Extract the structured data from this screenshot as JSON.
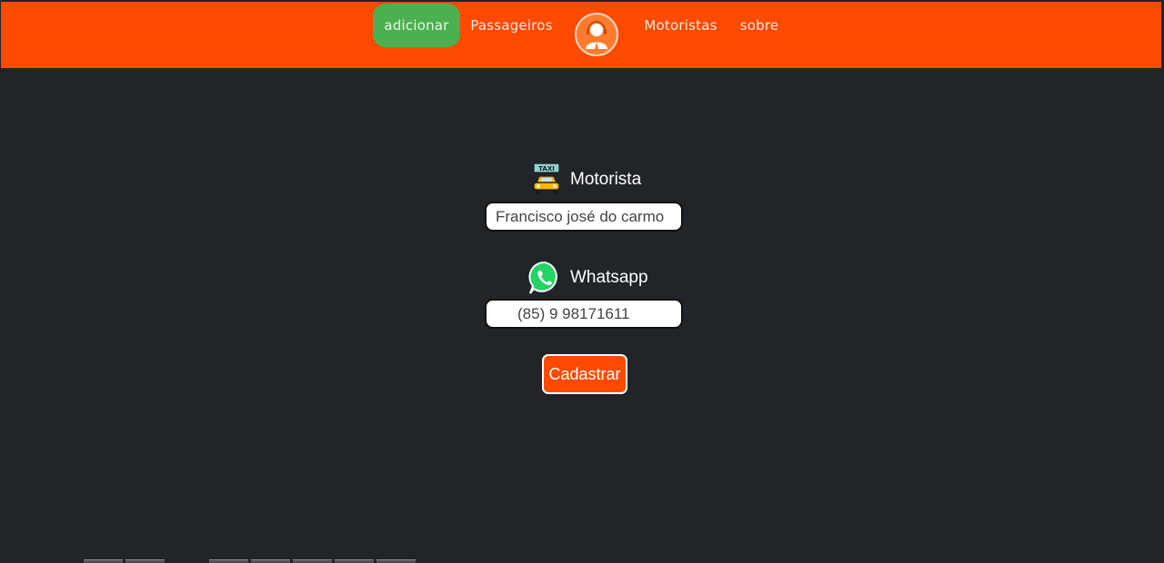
{
  "nav": {
    "items": [
      {
        "label": "adicionar",
        "active": true
      },
      {
        "label": "Passageiros",
        "active": false
      },
      {
        "label": "Motoristas",
        "active": false
      },
      {
        "label": "sobre",
        "active": false
      }
    ],
    "logo_icon": "support-agent-icon"
  },
  "form": {
    "motorista": {
      "label": "Motorista",
      "icon": "taxi-icon",
      "value": "Francisco josé do carmo"
    },
    "whatsapp": {
      "label": "Whatsapp",
      "icon": "whatsapp-icon",
      "value": "(85) 9 98171611"
    },
    "submit_label": "Cadastrar"
  },
  "colors": {
    "brand": "#ff4a00",
    "active_nav": "#4caf50",
    "background": "#212429",
    "whatsapp_green": "#25d366",
    "taxi_yellow": "#f5b800"
  }
}
